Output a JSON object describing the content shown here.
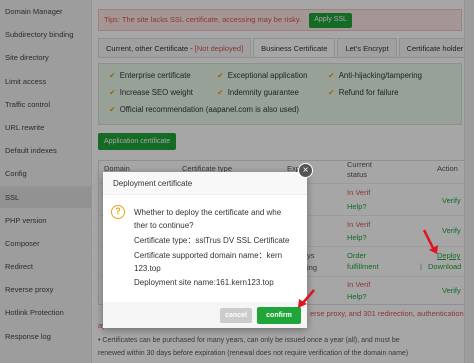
{
  "sidebar": {
    "items": [
      {
        "label": "Domain Manager"
      },
      {
        "label": "Subdirectory binding"
      },
      {
        "label": "Site directory"
      },
      {
        "label": "Limit access"
      },
      {
        "label": "Traffic control"
      },
      {
        "label": "URL rewrite"
      },
      {
        "label": "Default indexes"
      },
      {
        "label": "Config"
      },
      {
        "label": "SSL"
      },
      {
        "label": "PHP version"
      },
      {
        "label": "Composer"
      },
      {
        "label": "Redirect"
      },
      {
        "label": "Reverse proxy"
      },
      {
        "label": "Hotlink Protection"
      },
      {
        "label": "Response log"
      }
    ]
  },
  "tips": {
    "text": "Tips: The site lacks SSL certificate, accessing may be risky.",
    "button": "Apply SSL"
  },
  "tabs": [
    {
      "label": "Current, other Certificate - ",
      "label_red": "[Not deployed]"
    },
    {
      "label": "Business Certificate"
    },
    {
      "label": "Let's Encrypt"
    },
    {
      "label": "Certificate holder"
    }
  ],
  "features": [
    "Enterprise certificate",
    "Exceptional application",
    "Anti-hijacking/tampering",
    "Increase SEO weight",
    "Indemnity guarantee",
    "Refund for failure",
    "Official recommendation (aapanel.com is also used)"
  ],
  "application_button": "Application certificate",
  "table": {
    "headers": {
      "domain": "Domain",
      "type": "Certificate type",
      "expire": "Expire",
      "status": "Current status",
      "action": "Action"
    },
    "rows": [
      {
        "status_a": "In Verif",
        "status_b": "Help?",
        "action": "Verify"
      },
      {
        "status_a": "In Verif",
        "status_b": "Help?",
        "action": "Verify"
      },
      {
        "expire": "ys",
        "expire_b": "ing",
        "status_a": "Order",
        "status_b": "fulfillment",
        "action_a": "Deploy",
        "action_b": "Download"
      },
      {
        "status_a": "In Verif",
        "status_b": "Help?",
        "action": "Verify"
      }
    ]
  },
  "footnote_red_a": "ay",
  "footnote_red_b": "erse proxy, and 301 redirection, authentication",
  "bullets": [
    "• Certificates can be purchased for many years, can only be issued once a year (all), and must be",
    "renewed within 30 days before expiration (renewal does not require verification of the domain name)"
  ],
  "dialog": {
    "title": "Deployment certificate",
    "question_line1": "Whether to deploy the certificate and whe",
    "question_line2": "ther to continue?",
    "cert_type": "Certificate type：sslTrus DV SSL Certificate",
    "domain_line1": "Certificate supported domain name：kern",
    "domain_line2": "123.top",
    "deploy_site": "Deployment site name:161.kern123.top",
    "cancel": "cancel",
    "confirm": "confirm"
  },
  "colors": {
    "accent_green": "#20a53a",
    "warning_red": "#d9534f",
    "check_orange": "#e8a317",
    "arrow_red": "#e0141e"
  }
}
